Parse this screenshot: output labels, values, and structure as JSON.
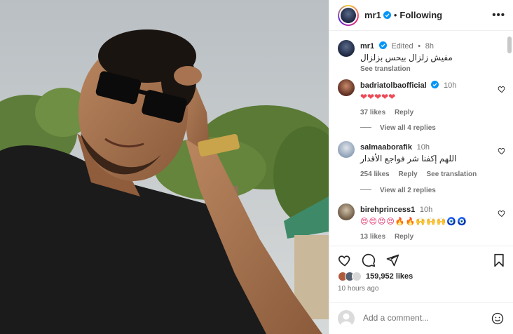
{
  "post": {
    "username": "mr1",
    "following_label": "Following",
    "more_label": "•••",
    "caption": {
      "username": "mr1",
      "edited": "Edited",
      "time": "8h",
      "text": "مفيش زلزال بيحس بزلزال",
      "see_translation": "See translation"
    }
  },
  "comments": [
    {
      "username": "badriatolbaofficial",
      "verified": true,
      "time": "10h",
      "text": "❤❤❤❤❤",
      "likes": "37 likes",
      "reply": "Reply",
      "see_translation": "",
      "view_replies": "View all 4 replies"
    },
    {
      "username": "salmaaborafik",
      "verified": false,
      "time": "10h",
      "text": "اللهم إكفنا شر فواجع الأقدار",
      "likes": "254 likes",
      "reply": "Reply",
      "see_translation": "See translation",
      "view_replies": "View all 2 replies"
    },
    {
      "username": "birehprincess1",
      "verified": false,
      "time": "10h",
      "text": "😍😍😍😍🔥🔥🙌🙌🙌🧿🧿",
      "likes": "13 likes",
      "reply": "Reply",
      "see_translation": "",
      "view_replies": ""
    }
  ],
  "actions": {
    "likes": "159,952 likes",
    "time_ago": "10 hours ago",
    "add_comment_placeholder": "Add a comment..."
  },
  "colors": {
    "verified": "#0095f6",
    "heart_red": "#ed4956",
    "text": "#262626",
    "muted": "#737373"
  }
}
